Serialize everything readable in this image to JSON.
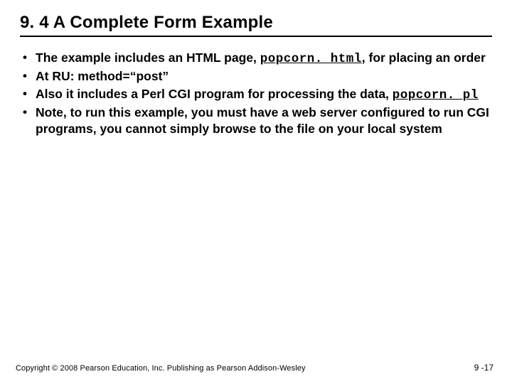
{
  "title": "9. 4 A Complete Form Example",
  "bullets": {
    "b1a": "The example includes an HTML page, ",
    "b1_code": "popcorn. html",
    "b1b": ", for placing an order",
    "b2": "At RU: method=“post”",
    "b3a": "Also it includes a Perl CGI program for processing the data, ",
    "b3_code": "popcorn. pl",
    "b4": "Note, to run this example, you must have a web server configured to run CGI programs, you cannot simply browse to the file on your local system"
  },
  "footer": "Copyright © 2008 Pearson Education, Inc. Publishing as Pearson Addison-Wesley",
  "page_number": "9 -17"
}
